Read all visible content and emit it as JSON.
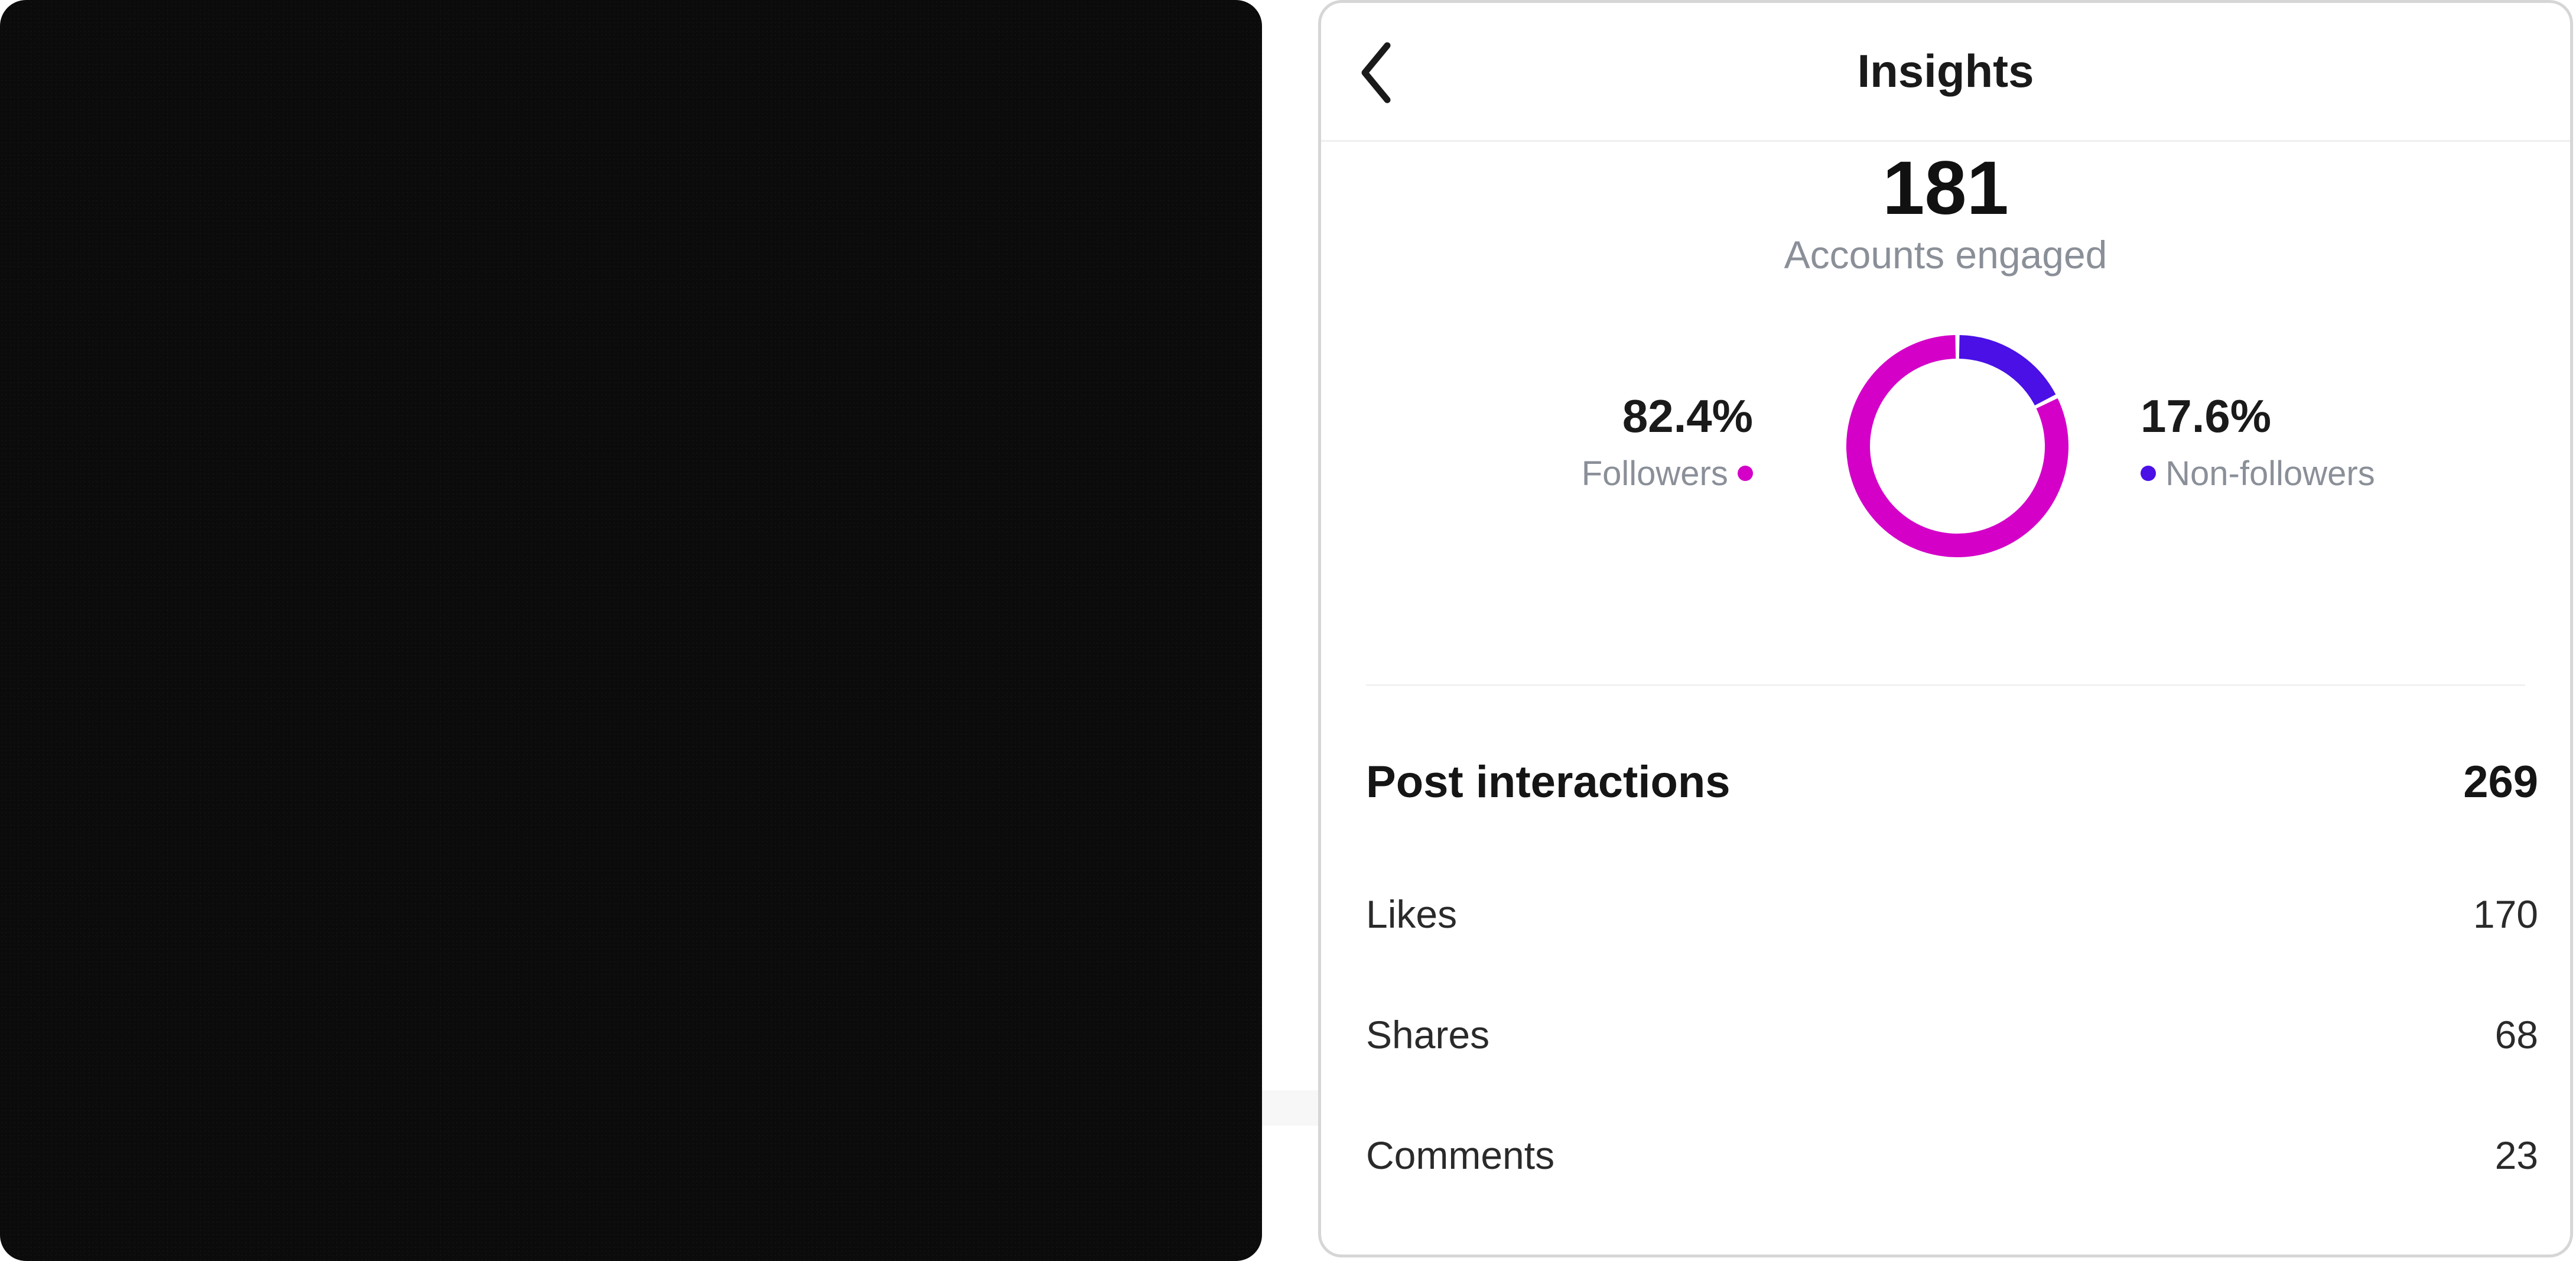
{
  "header": {
    "title": "Insights"
  },
  "accounts": {
    "count": "181",
    "label": "Accounts engaged"
  },
  "breakdown": {
    "followers": {
      "percent": "82.4%",
      "label": "Followers",
      "color": "#d400c8"
    },
    "non_followers": {
      "percent": "17.6%",
      "label": "Non-followers",
      "color": "#4a10e6"
    }
  },
  "chart_data": {
    "type": "pie",
    "categories": [
      "Followers",
      "Non-followers"
    ],
    "values": [
      82.4,
      17.6
    ],
    "colors": [
      "#d400c8",
      "#4a10e6"
    ]
  },
  "interactions": {
    "title": "Post interactions",
    "total": "269",
    "items": [
      {
        "label": "Likes",
        "value": "170"
      },
      {
        "label": "Shares",
        "value": "68"
      },
      {
        "label": "Comments",
        "value": "23"
      }
    ]
  },
  "icons": {
    "back": "chevron-left-icon"
  }
}
